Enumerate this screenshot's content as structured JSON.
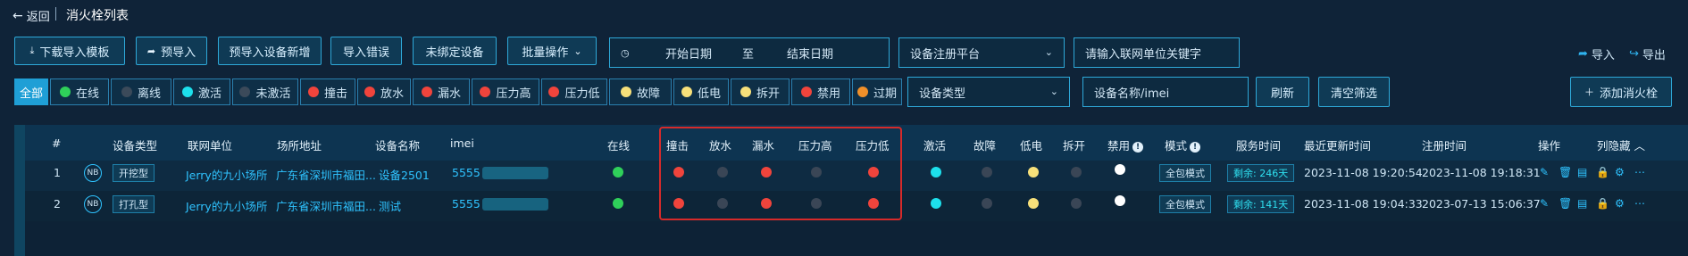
{
  "header": {
    "back_label": "返回",
    "title": "消火栓列表"
  },
  "toolbar": {
    "download_template": "下载导入模板",
    "pre_import": "预导入",
    "pre_import_new": "预导入设备新增",
    "import_error": "导入错误",
    "unbound": "未绑定设备",
    "batch": "批量操作",
    "date_start": "开始日期",
    "date_sep": "至",
    "date_end": "结束日期",
    "platform_placeholder": "设备注册平台",
    "unit_placeholder": "请输入联网单位关键字",
    "import_link": "导入",
    "export_link": "导出"
  },
  "filters": [
    {
      "label": "全部",
      "color": ""
    },
    {
      "label": "在线",
      "color": "#2fd05a"
    },
    {
      "label": "离线",
      "color": "#3b4a5a"
    },
    {
      "label": "激活",
      "color": "#1de0ec"
    },
    {
      "label": "未激活",
      "color": "#3b4a5a"
    },
    {
      "label": "撞击",
      "color": "#f0443c"
    },
    {
      "label": "放水",
      "color": "#f0443c"
    },
    {
      "label": "漏水",
      "color": "#f0443c"
    },
    {
      "label": "压力高",
      "color": "#f0443c"
    },
    {
      "label": "压力低",
      "color": "#f0443c"
    },
    {
      "label": "故障",
      "color": "#f7e07a"
    },
    {
      "label": "低电",
      "color": "#f7e07a"
    },
    {
      "label": "拆开",
      "color": "#f7e07a"
    },
    {
      "label": "禁用",
      "color": "#f0443c"
    },
    {
      "label": "过期",
      "color": "#f0902a"
    }
  ],
  "filter_row": {
    "device_type_placeholder": "设备类型",
    "name_placeholder": "设备名称/imei",
    "refresh": "刷新",
    "clear": "清空筛选",
    "add": "添加消火栓"
  },
  "table": {
    "headers": {
      "index": "#",
      "type": "设备类型",
      "unit": "联网单位",
      "address": "场所地址",
      "name": "设备名称",
      "imei": "imei",
      "online": "在线",
      "impact": "撞击",
      "discharge": "放水",
      "leak": "漏水",
      "p_high": "压力高",
      "p_low": "压力低",
      "activate": "激活",
      "fault": "故障",
      "low_batt": "低电",
      "open": "拆开",
      "disable": "禁用",
      "mode": "模式",
      "service": "服务时间",
      "updated": "最近更新时间",
      "registered": "注册时间",
      "ops": "操作",
      "hide": "列隐藏"
    },
    "rows": [
      {
        "index": "1",
        "nb": "NB",
        "type": "开挖型",
        "unit": "Jerry的九小场所",
        "address": "广东省深圳市福田...",
        "name": "设备2501",
        "imei": "5555",
        "mode": "全包模式",
        "service": "剩余: 246天",
        "updated": "2023-11-08 19:20:54",
        "registered": "2023-11-08 19:18:31"
      },
      {
        "index": "2",
        "nb": "NB",
        "type": "打孔型",
        "unit": "Jerry的九小场所",
        "address": "广东省深圳市福田...",
        "name": "测试",
        "imei": "5555",
        "mode": "全包模式",
        "service": "剩余: 141天",
        "updated": "2023-11-08 19:04:33",
        "registered": "2023-07-13 15:06:37"
      }
    ],
    "status_colors": {
      "green": "#2fd05a",
      "red": "#f0443c",
      "gray": "#3a4656",
      "cyan": "#1de0ec",
      "yellow": "#f7e07a",
      "white": "#ffffff"
    }
  }
}
